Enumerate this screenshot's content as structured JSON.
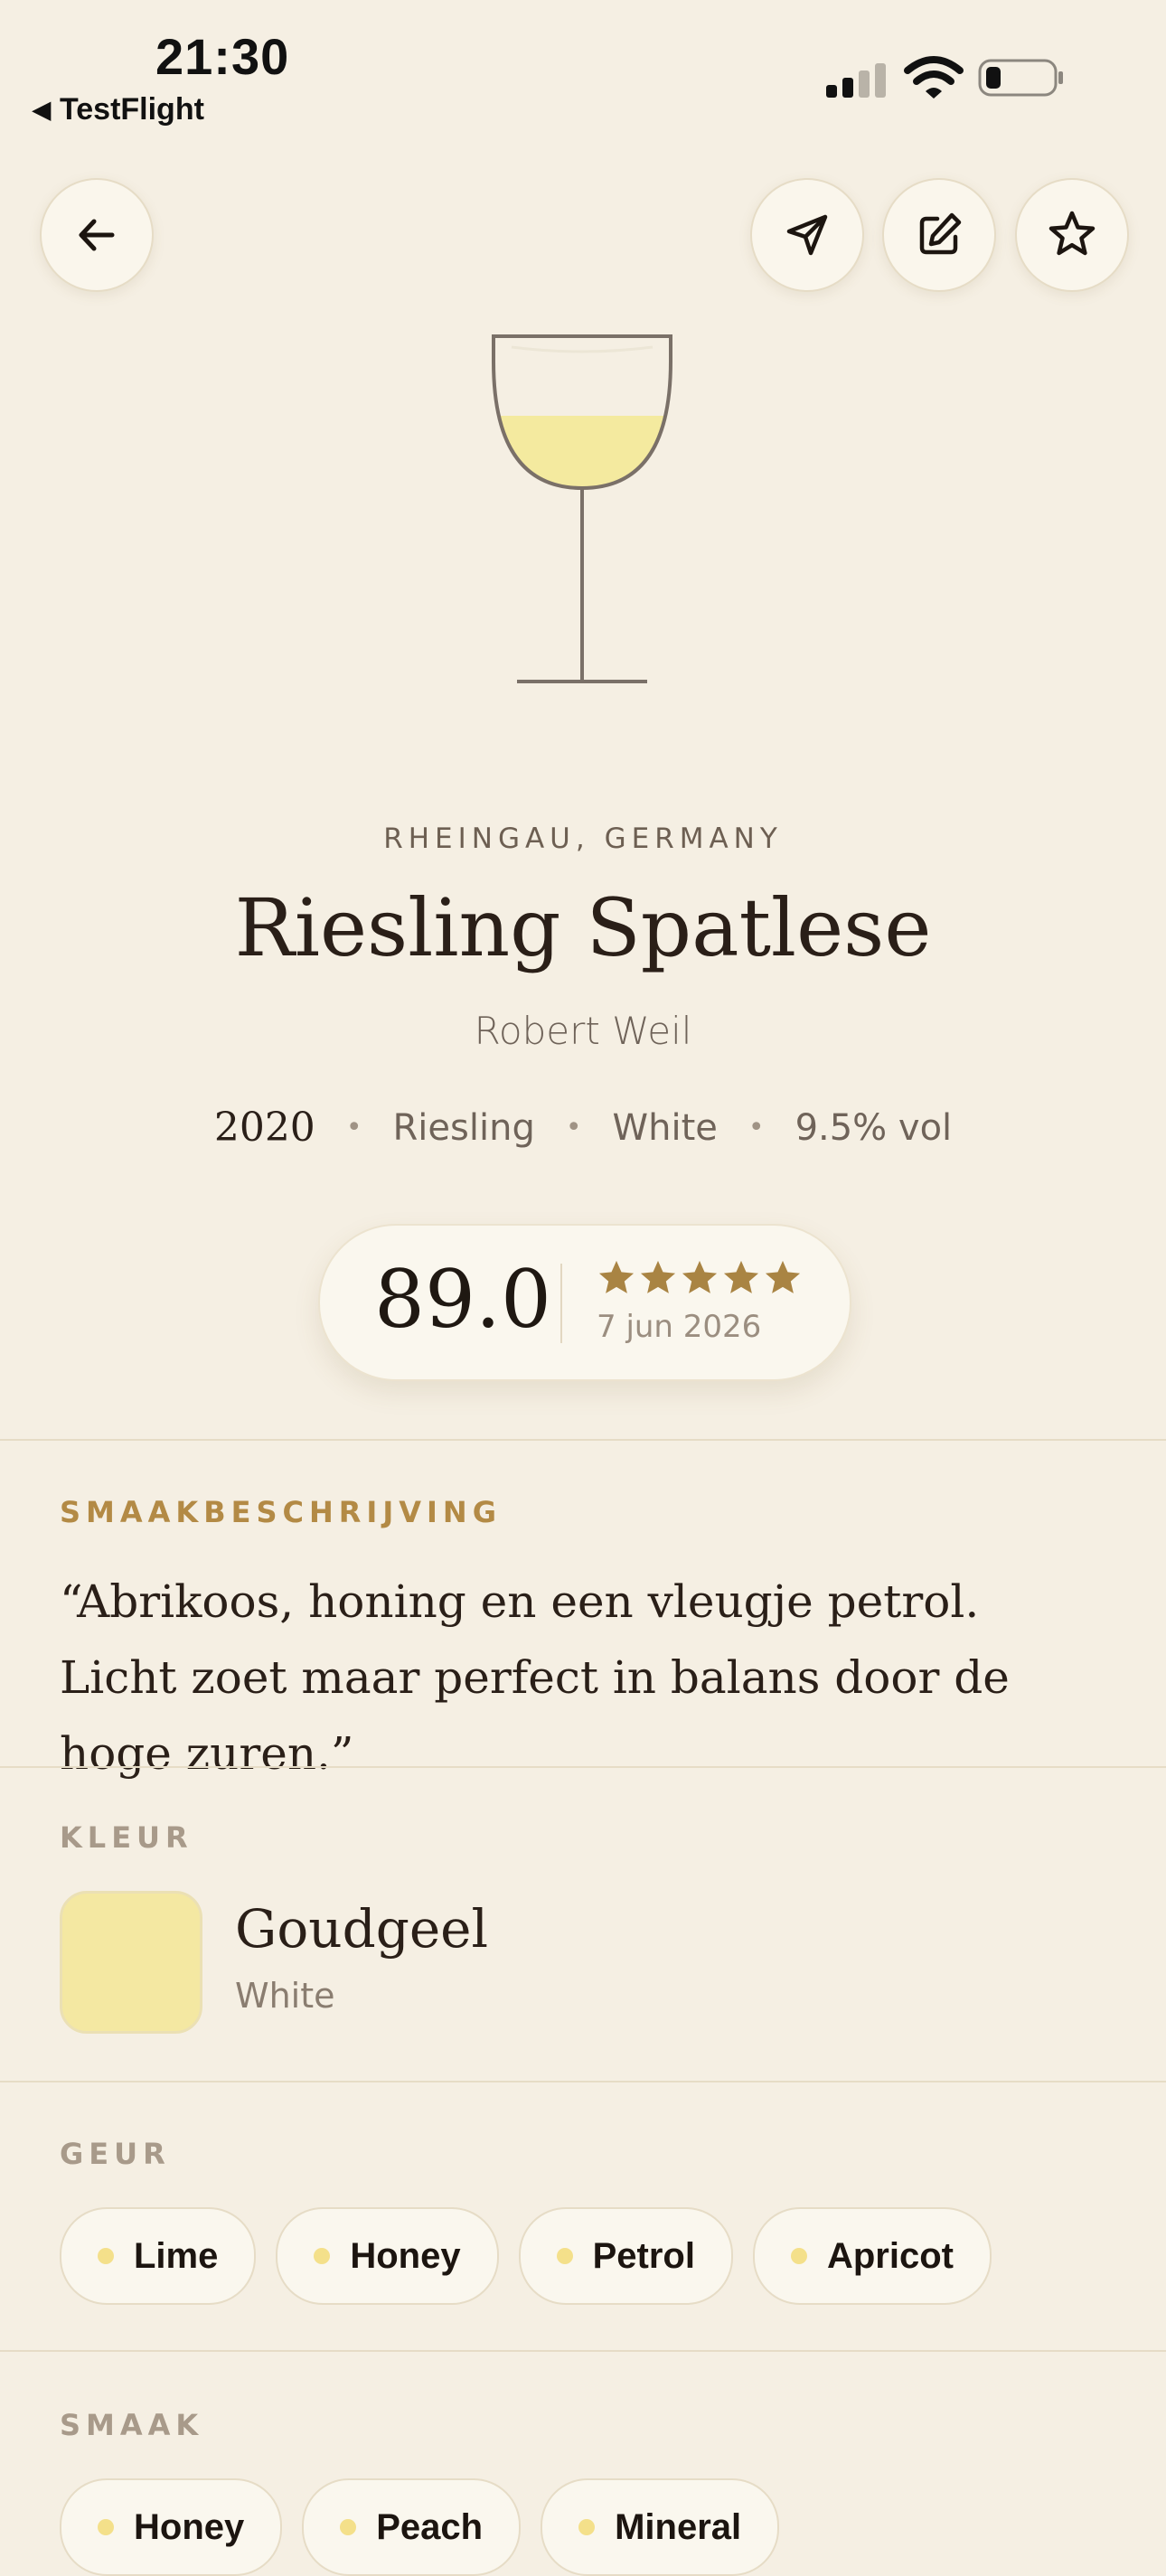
{
  "status_bar": {
    "time": "21:30",
    "back_app": "TestFlight"
  },
  "toolbar": {
    "back_icon": "arrow-left-icon",
    "share_icon": "send-icon",
    "edit_icon": "edit-icon",
    "favorite_icon": "star-outline-icon"
  },
  "wine": {
    "region": "RHEINGAU, GERMANY",
    "name": "Riesling Spatlese",
    "producer": "Robert Weil",
    "vintage": "2020",
    "grape": "Riesling",
    "type": "White",
    "abv": "9.5% vol",
    "glass_fill_color": "#f4ea9f"
  },
  "rating": {
    "score": "89.0",
    "stars": 5,
    "stars_max": 5,
    "date": "7 jun 2026",
    "star_color": "#a98443"
  },
  "tasting": {
    "label": "SMAAKBESCHRIJVING",
    "quote": "“Abrikoos, honing en een vleugje petrol. Licht zoet maar perfect in balans door de hoge zuren.”"
  },
  "color": {
    "label": "KLEUR",
    "name": "Goudgeel",
    "sub": "White",
    "swatch": "#f4e8a2"
  },
  "aroma": {
    "label": "GEUR",
    "chips": [
      "Lime",
      "Honey",
      "Petrol",
      "Apricot"
    ]
  },
  "taste": {
    "label": "SMAAK",
    "chips": [
      "Honey",
      "Peach",
      "Mineral"
    ]
  }
}
